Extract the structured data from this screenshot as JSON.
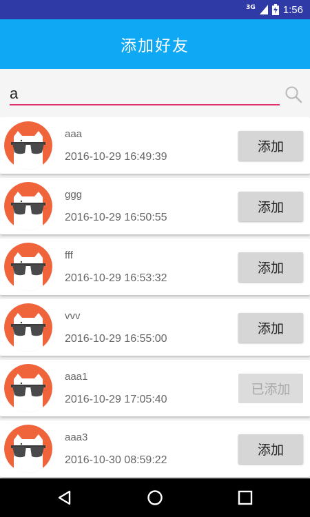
{
  "status_bar": {
    "network": "3G",
    "time": "1:56"
  },
  "header": {
    "title": "添加好友"
  },
  "search": {
    "value": "a",
    "placeholder": ""
  },
  "friends": [
    {
      "name": "aaa",
      "time": "2016-10-29 16:49:39",
      "button": "添加",
      "added": false
    },
    {
      "name": "ggg",
      "time": "2016-10-29 16:50:55",
      "button": "添加",
      "added": false
    },
    {
      "name": "fff",
      "time": "2016-10-29 16:53:32",
      "button": "添加",
      "added": false
    },
    {
      "name": "vvv",
      "time": "2016-10-29 16:55:00",
      "button": "添加",
      "added": false
    },
    {
      "name": "aaa1",
      "time": "2016-10-29 17:05:40",
      "button": "已添加",
      "added": true
    },
    {
      "name": "aaa3",
      "time": "2016-10-30 08:59:22",
      "button": "添加",
      "added": false
    }
  ],
  "icons": {
    "search": "search-icon",
    "avatar": "cat-sunglasses-avatar",
    "back": "back-icon",
    "home": "home-icon",
    "recents": "recents-icon"
  },
  "colors": {
    "status_bar": "#2f3aa6",
    "app_bar": "#0ea8f5",
    "input_underline": "#e0306f",
    "avatar_bg": "#f0643c",
    "button_bg": "#d6d6d6"
  }
}
